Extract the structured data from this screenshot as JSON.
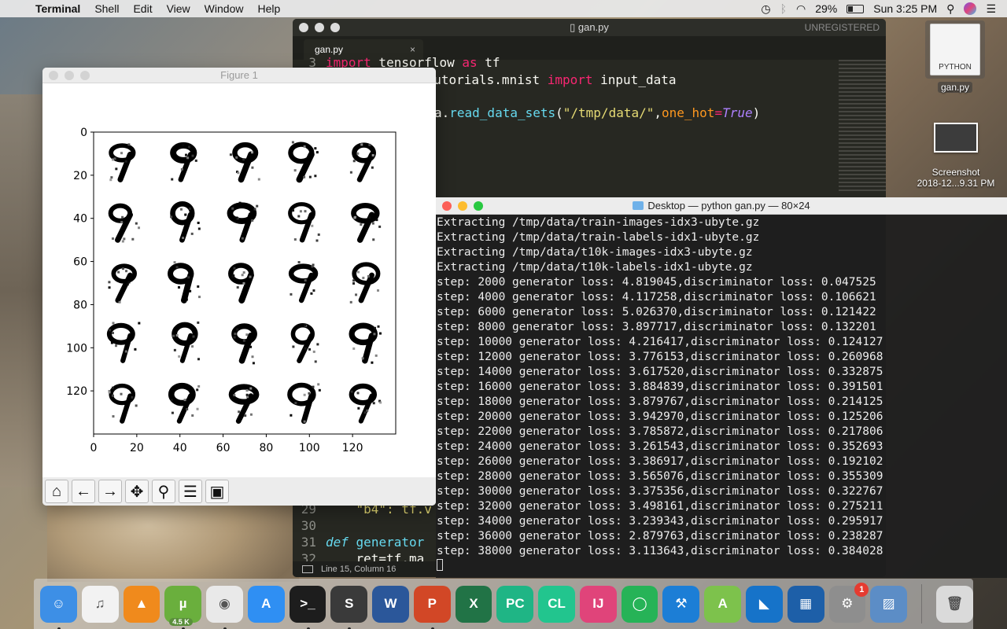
{
  "menubar": {
    "app_name": "Terminal",
    "items": [
      "Shell",
      "Edit",
      "View",
      "Window",
      "Help"
    ],
    "battery": "29%",
    "clock": "Sun 3:25 PM"
  },
  "editor": {
    "title": "gan.py",
    "unregistered": "UNREGISTERED",
    "tab": "gan.py",
    "status": "Line 15, Column 16",
    "lines": [
      {
        "num": "3",
        "html_parts": [
          [
            "kw",
            "import"
          ],
          [
            "txt",
            " tensorflow "
          ],
          [
            "kw",
            "as"
          ],
          [
            "txt",
            " tf"
          ]
        ]
      },
      {
        "num": "",
        "html_parts": [
          [
            "txt",
            "    "
          ],
          [
            "txt",
            "from tensorflow.examples.tutorials.mnist "
          ],
          [
            "kw",
            "import"
          ],
          [
            "txt",
            " input_data"
          ]
        ]
      },
      {
        "num": "",
        "html_parts": [
          [
            "txt",
            ""
          ]
        ]
      },
      {
        "num": "",
        "html_parts": [
          [
            "txt",
            "mnist = input_data."
          ],
          [
            "fn",
            "read_data_sets"
          ],
          [
            "txt",
            "("
          ],
          [
            "str",
            "\"/tmp/data/\""
          ],
          [
            "txt",
            ","
          ],
          [
            "attr",
            "one_hot"
          ],
          [
            "kw",
            "="
          ],
          [
            "num",
            "True"
          ],
          [
            "txt",
            ")"
          ]
        ]
      }
    ],
    "visible_code": {
      "line3_text": "import tensorflow as tf",
      "line4_text": "ow.examples.tutorials.mnist import input_data",
      "line6_text": "a.read_data_sets(\"/tmp/data/\",one_hot=True)",
      "line29_num": "29",
      "line29_text": "\"b4\": tf.v",
      "line30_num": "30",
      "line31_num": "31",
      "line31_kw": "def",
      "line31_text": "generator",
      "line32_num": "32",
      "line32_text": "ret=tf.ma"
    }
  },
  "figure": {
    "title": "Figure 1",
    "y_ticks": [
      "0",
      "20",
      "40",
      "60",
      "80",
      "100",
      "120"
    ],
    "x_ticks": [
      "0",
      "20",
      "40",
      "60",
      "80",
      "100",
      "120"
    ],
    "toolbar": [
      {
        "name": "home-button",
        "icon": "home-icon",
        "glyph": "⌂"
      },
      {
        "name": "back-button",
        "icon": "arrow-left-icon",
        "glyph": "←"
      },
      {
        "name": "forward-button",
        "icon": "arrow-right-icon",
        "glyph": "→"
      },
      {
        "name": "pan-button",
        "icon": "move-icon",
        "glyph": "✥"
      },
      {
        "name": "zoom-button",
        "icon": "magnifier-icon",
        "glyph": "⚲"
      },
      {
        "name": "subplots-button",
        "icon": "sliders-icon",
        "glyph": "☰"
      },
      {
        "name": "save-button",
        "icon": "floppy-icon",
        "glyph": "▣"
      }
    ]
  },
  "terminal": {
    "title": "Desktop — python gan.py — 80×24",
    "lines": [
      "Extracting /tmp/data/train-images-idx3-ubyte.gz",
      "Extracting /tmp/data/train-labels-idx1-ubyte.gz",
      "Extracting /tmp/data/t10k-images-idx3-ubyte.gz",
      "Extracting /tmp/data/t10k-labels-idx1-ubyte.gz",
      "step: 2000 generator loss: 4.819045,discriminator loss: 0.047525",
      "step: 4000 generator loss: 4.117258,discriminator loss: 0.106621",
      "step: 6000 generator loss: 5.026370,discriminator loss: 0.121422",
      "step: 8000 generator loss: 3.897717,discriminator loss: 0.132201",
      "step: 10000 generator loss: 4.216417,discriminator loss: 0.124127",
      "step: 12000 generator loss: 3.776153,discriminator loss: 0.260968",
      "step: 14000 generator loss: 3.617520,discriminator loss: 0.332875",
      "step: 16000 generator loss: 3.884839,discriminator loss: 0.391501",
      "step: 18000 generator loss: 3.879767,discriminator loss: 0.214125",
      "step: 20000 generator loss: 3.942970,discriminator loss: 0.125206",
      "step: 22000 generator loss: 3.785872,discriminator loss: 0.217806",
      "step: 24000 generator loss: 3.261543,discriminator loss: 0.352693",
      "step: 26000 generator loss: 3.386917,discriminator loss: 0.192102",
      "step: 28000 generator loss: 3.565076,discriminator loss: 0.355309",
      "step: 30000 generator loss: 3.375356,discriminator loss: 0.322767",
      "step: 32000 generator loss: 3.498161,discriminator loss: 0.275211",
      "step: 34000 generator loss: 3.239343,discriminator loss: 0.295917",
      "step: 36000 generator loss: 2.879763,discriminator loss: 0.238287",
      "step: 38000 generator loss: 3.113643,discriminator loss: 0.384028"
    ]
  },
  "desktop": {
    "file_icon_label": "gan.py",
    "file_icon_type": "PYTHON",
    "screenshot_label_1": "Screenshot",
    "screenshot_label_2": "2018-12...9.31 PM"
  },
  "dock": {
    "apps": [
      {
        "name": "finder",
        "color": "#3d8fe6",
        "glyph": "☺",
        "running": true
      },
      {
        "name": "itunes",
        "color": "#f2f2f2",
        "glyph": "♫",
        "running": false
      },
      {
        "name": "vlc",
        "color": "#f08a1c",
        "glyph": "▲",
        "running": false
      },
      {
        "name": "utorrent",
        "color": "#6aaf3d",
        "glyph": "µ",
        "running": true,
        "badge_text": "4.5 K"
      },
      {
        "name": "chrome",
        "color": "#e9e9e9",
        "glyph": "◉",
        "running": true
      },
      {
        "name": "app-store",
        "color": "#2f8ff3",
        "glyph": "A",
        "running": false
      },
      {
        "name": "terminal",
        "color": "#1d1d1d",
        "glyph": ">_",
        "running": true
      },
      {
        "name": "sublime-text",
        "color": "#3a3a3a",
        "glyph": "S",
        "running": true
      },
      {
        "name": "word",
        "color": "#2b579a",
        "glyph": "W",
        "running": false
      },
      {
        "name": "powerpoint",
        "color": "#d24726",
        "glyph": "P",
        "running": true
      },
      {
        "name": "excel",
        "color": "#217346",
        "glyph": "X",
        "running": false
      },
      {
        "name": "pycharm",
        "color": "#1fb585",
        "glyph": "PC",
        "running": false
      },
      {
        "name": "clion",
        "color": "#22c58e",
        "glyph": "CL",
        "running": false
      },
      {
        "name": "intellij",
        "color": "#e0447a",
        "glyph": "IJ",
        "running": false
      },
      {
        "name": "spinner-app",
        "color": "#26b357",
        "glyph": "◯",
        "running": false
      },
      {
        "name": "xcode",
        "color": "#1c7ed6",
        "glyph": "⚒",
        "running": false
      },
      {
        "name": "android-studio",
        "color": "#7dc24c",
        "glyph": "A",
        "running": false
      },
      {
        "name": "wireshark",
        "color": "#1673c9",
        "glyph": "◣",
        "running": false
      },
      {
        "name": "virtualbox",
        "color": "#1d5fa8",
        "glyph": "▦",
        "running": false
      },
      {
        "name": "system-preferences",
        "color": "#8e8e8e",
        "glyph": "⚙",
        "running": false,
        "notification": "1"
      },
      {
        "name": "preview",
        "color": "#5c8dc6",
        "glyph": "▨",
        "running": false
      }
    ],
    "trash": {
      "name": "trash",
      "color": "#dadada",
      "glyph": "🗑"
    }
  }
}
